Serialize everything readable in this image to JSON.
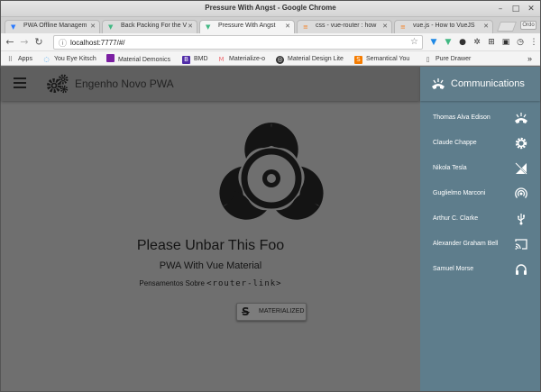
{
  "window": {
    "title": "Pressure With Angst - Google Chrome"
  },
  "tabs": [
    {
      "label": "PWA Offline Managem",
      "icon": "favicon-blue"
    },
    {
      "label": "Back Packing For the V",
      "icon": "vue-icon"
    },
    {
      "label": "Pressure With Angst",
      "icon": "vue-icon"
    },
    {
      "label": "css - vue-router : how",
      "icon": "stackoverflow-icon"
    },
    {
      "label": "vue.js - How to VueJS",
      "icon": "stackoverflow-icon"
    }
  ],
  "profile_label": "Ordo",
  "address": {
    "url": "localhost:7777/#/"
  },
  "bookmarks": [
    {
      "label": "Apps"
    },
    {
      "label": "You Eye Kitsch"
    },
    {
      "label": "Material Demonics"
    },
    {
      "label": "BMD"
    },
    {
      "label": "Materialize-o"
    },
    {
      "label": "Material Design Lite"
    },
    {
      "label": "Semantical You"
    },
    {
      "label": "Pure Drawer"
    }
  ],
  "bookmarks_overflow": "»",
  "app": {
    "title": "Engenho Novo PWA"
  },
  "hero": {
    "title": "Please Unbar This Foo",
    "subtitle": "PWA With Vue Material",
    "text_prefix": "Pensamentos Sobre",
    "code": "<router-link>",
    "button": "MATERIALIZED"
  },
  "drawer": {
    "title": "Communications",
    "items": [
      {
        "label": "Thomas Alva Edison",
        "icon": "ring-volume-icon"
      },
      {
        "label": "Claude Chappe",
        "icon": "settings-icon"
      },
      {
        "label": "Nikola Tesla",
        "icon": "signal-off-icon"
      },
      {
        "label": "Guglielmo Marconi",
        "icon": "wifi-tethering-icon"
      },
      {
        "label": "Arthur C. Clarke",
        "icon": "usb-icon"
      },
      {
        "label": "Alexander Graham Bell",
        "icon": "cast-icon"
      },
      {
        "label": "Samuel Morse",
        "icon": "headset-icon"
      }
    ]
  },
  "colors": {
    "drawer": "#607d8b",
    "overlay": "#6f6f6f",
    "appbar": "#5f5f5f"
  }
}
